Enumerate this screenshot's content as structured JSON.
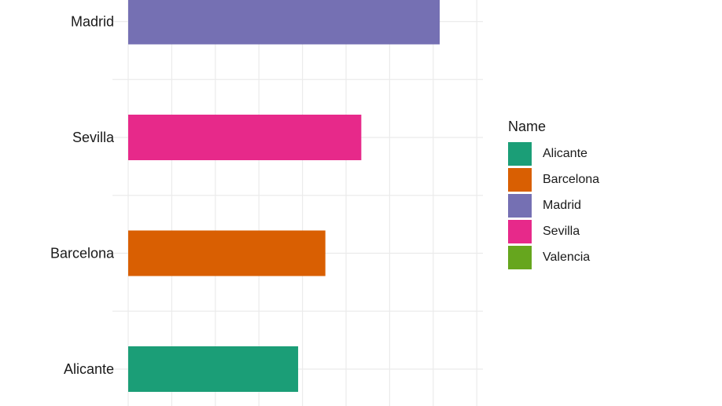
{
  "chart_data": {
    "type": "bar",
    "orientation": "horizontal",
    "categories": [
      "Alicante",
      "Barcelona",
      "Sevilla",
      "Madrid",
      "Valencia"
    ],
    "values": [
      7.8,
      9.05,
      10.7,
      14.3,
      null
    ],
    "colors": {
      "Alicante": "#1b9e77",
      "Barcelona": "#d95f02",
      "Madrid": "#7570b3",
      "Sevilla": "#e7298a",
      "Valencia": "#66a61e"
    },
    "grid": true,
    "legend": {
      "title": "Name",
      "position": "right",
      "entries": [
        "Alicante",
        "Barcelona",
        "Madrid",
        "Sevilla",
        "Valencia"
      ]
    }
  }
}
